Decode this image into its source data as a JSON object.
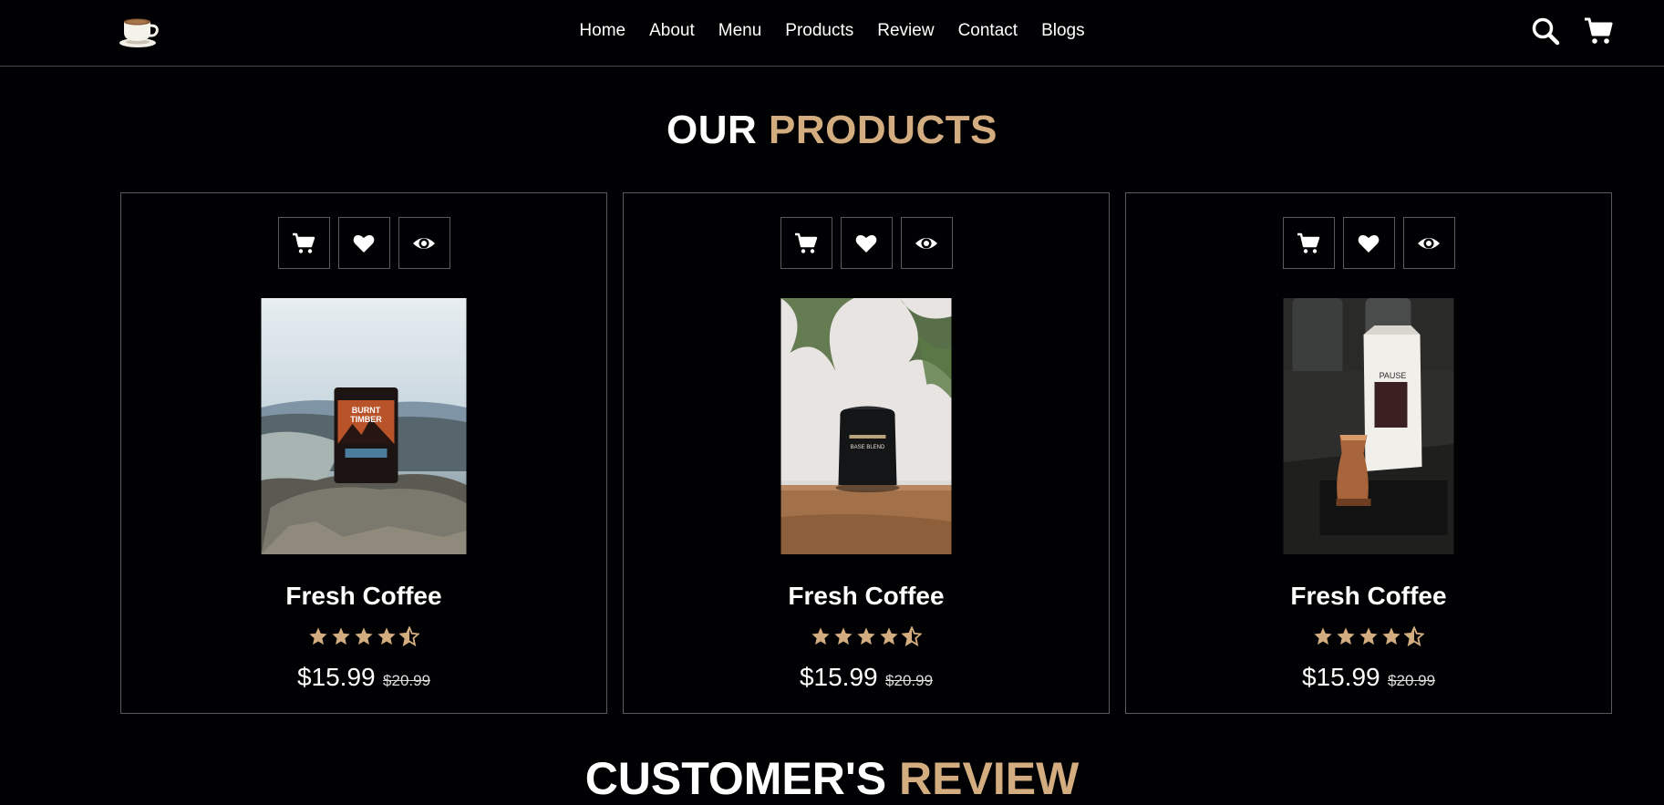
{
  "nav": {
    "items": [
      "Home",
      "About",
      "Menu",
      "Products",
      "Review",
      "Contact",
      "Blogs"
    ]
  },
  "header_icons": [
    "search-icon",
    "cart-icon"
  ],
  "products_section": {
    "title_main": "OUR",
    "title_accent": "PRODUCTS"
  },
  "products": [
    {
      "name": "Fresh Coffee",
      "rating": 4.5,
      "price": "$15.99",
      "old_price": "$20.99",
      "actions": [
        "cart-icon",
        "heart-icon",
        "eye-icon"
      ]
    },
    {
      "name": "Fresh Coffee",
      "rating": 4.5,
      "price": "$15.99",
      "old_price": "$20.99",
      "actions": [
        "cart-icon",
        "heart-icon",
        "eye-icon"
      ]
    },
    {
      "name": "Fresh Coffee",
      "rating": 4.5,
      "price": "$15.99",
      "old_price": "$20.99",
      "actions": [
        "cart-icon",
        "heart-icon",
        "eye-icon"
      ]
    }
  ],
  "review_section": {
    "title_main": "CUSTOMER's",
    "title_accent": "REVIEW"
  },
  "colors": {
    "background": "#010103",
    "accent": "#d3ad7f",
    "border": "#5a5a5a",
    "star": "#d3ad7f"
  }
}
